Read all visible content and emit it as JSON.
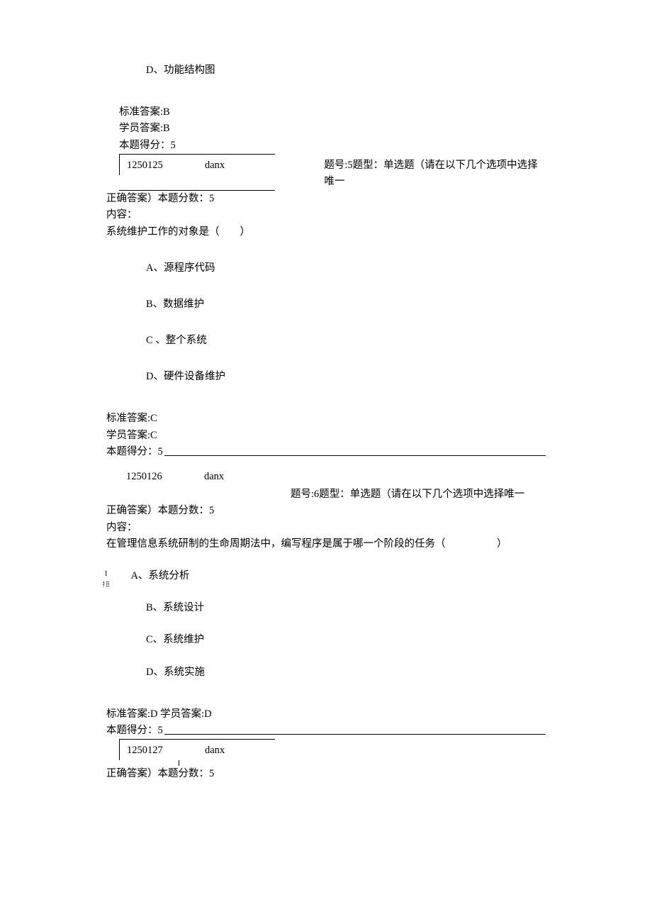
{
  "q4_partial": {
    "option_d": "D、功能结构图",
    "std_answer_label": "标准答案:B",
    "stu_answer_label": "学员答案:B",
    "score_label": "本题得分：5"
  },
  "q5": {
    "id_num": "1250125",
    "id_tag": "danx",
    "meta": "题号:5题型：单选题（请在以下几个选项中选择唯一",
    "meta2": "正确答案）本题分数：5",
    "content_label": "内容：",
    "stem": "系统维护工作的对象是（　　）",
    "option_a": "A、源程序代码",
    "option_b": "B、数据维护",
    "option_c": "C 、整个系统",
    "option_d": "D、硬件设备维护",
    "std_answer_label": "标准答案:C",
    "stu_answer_label": "学员答案:C",
    "score_label": "本题得分：5"
  },
  "q6": {
    "id_num": "1250126",
    "id_tag": "danx",
    "meta": "题号:6题型：单选题（请在以下几个选项中选择唯一",
    "meta2": "正确答案）本题分数：5",
    "content_label": "内容：",
    "stem": "在管理信息系统研制的生命周期法中，编写程序是属于哪一个阶段的任务（　　　　　）",
    "option_a": "A、系统分析",
    "option_b": "B、系统设计",
    "option_c": "C、系统维护",
    "option_d": "D、系统实施",
    "std_stu_answer_label": "标准答案:D 学员答案:D",
    "score_label": "本题得分：5"
  },
  "q7": {
    "id_num": "1250127",
    "id_tag": "danx",
    "meta2": "正确答案）本题分数：5"
  }
}
